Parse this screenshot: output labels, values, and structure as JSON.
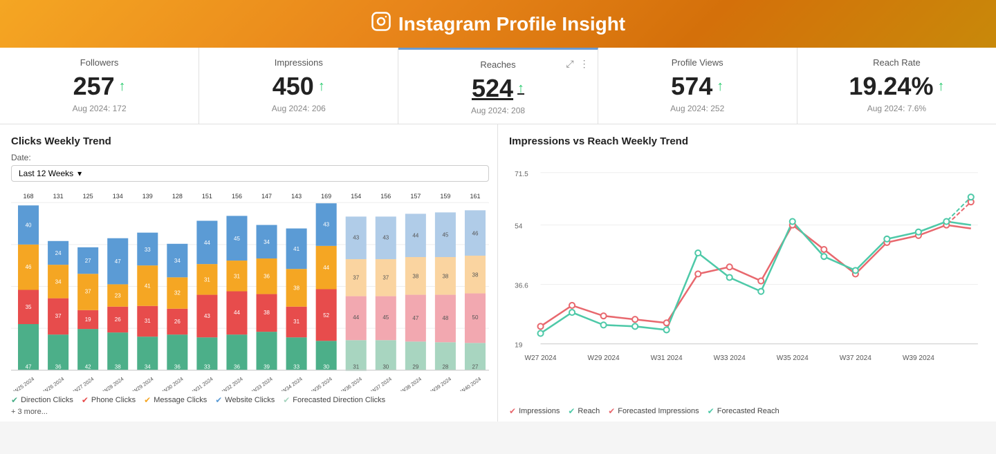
{
  "header": {
    "title": "Instagram Profile Insight",
    "icon": "📷"
  },
  "metrics": [
    {
      "id": "followers",
      "label": "Followers",
      "value": "257",
      "sub": "Aug 2024: 172",
      "highlighted": false
    },
    {
      "id": "impressions",
      "label": "Impressions",
      "value": "450",
      "sub": "Aug 2024: 206",
      "highlighted": false
    },
    {
      "id": "reaches",
      "label": "Reaches",
      "value": "524",
      "sub": "Aug 2024: 208",
      "highlighted": true,
      "underline": true
    },
    {
      "id": "profile-views",
      "label": "Profile Views",
      "value": "574",
      "sub": "Aug 2024: 252",
      "highlighted": false
    },
    {
      "id": "reach-rate",
      "label": "Reach Rate",
      "value": "19.24%",
      "sub": "Aug 2024: 7.6%",
      "highlighted": false
    }
  ],
  "left_chart": {
    "title": "Clicks Weekly Trend",
    "date_label": "Date:",
    "date_select": "Last 12 Weeks",
    "weeks": [
      "W25 2024",
      "W26 2024",
      "W27 2024",
      "W28 2024",
      "W29 2024",
      "W30 2024",
      "W31 2024",
      "W32 2024",
      "W33 2024",
      "W34 2024",
      "W35 2024",
      "W36 2024",
      "W37 2024",
      "W38 2024",
      "W39 2024",
      "W40 2024"
    ],
    "totals": [
      168,
      131,
      125,
      134,
      139,
      128,
      151,
      156,
      147,
      143,
      169,
      154,
      156,
      157,
      159,
      161
    ],
    "legend": [
      {
        "label": "Direction Clicks",
        "color": "#4caf89"
      },
      {
        "label": "Phone Clicks",
        "color": "#e74c4c"
      },
      {
        "label": "Message Clicks",
        "color": "#f5a623"
      },
      {
        "label": "Website Clicks",
        "color": "#5b9bd5"
      },
      {
        "label": "Forecasted Direction Clicks",
        "color": "#a8d5c0"
      }
    ],
    "more": "+ 3 more..."
  },
  "right_chart": {
    "title": "Impressions vs Reach Weekly Trend",
    "y_labels": [
      "71.5",
      "54",
      "36.6",
      "19"
    ],
    "x_labels": [
      "W27 2024",
      "W29 2024",
      "W31 2024",
      "W33 2024",
      "W35 2024",
      "W37 2024",
      "W39 2024"
    ],
    "legend": [
      {
        "label": "Impressions",
        "color": "#e8686e"
      },
      {
        "label": "Reach",
        "color": "#4ec9a8"
      },
      {
        "label": "Forecasted Impressions",
        "color": "#e8686e",
        "dashed": true
      },
      {
        "label": "Forecasted Reach",
        "color": "#4ec9a8",
        "dashed": true
      }
    ]
  }
}
